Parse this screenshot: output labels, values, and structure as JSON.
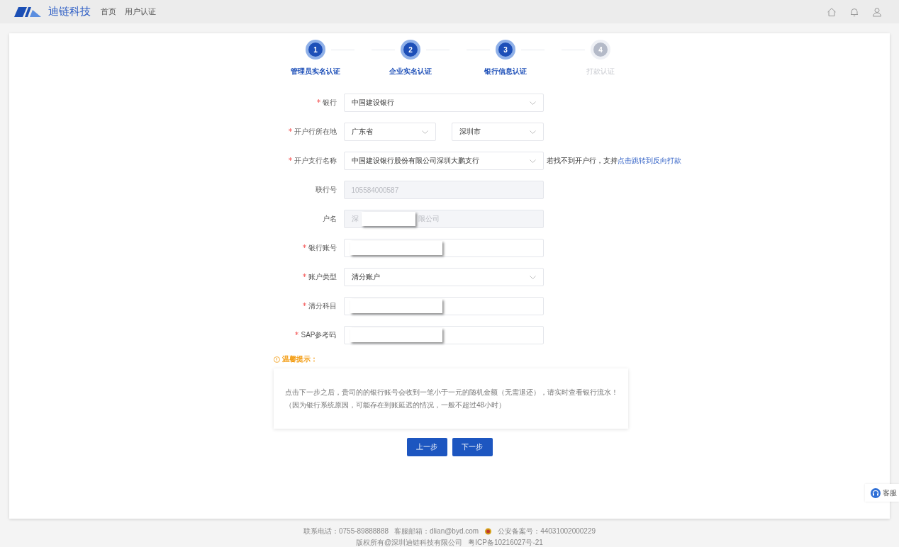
{
  "header": {
    "brand": "迪链科技",
    "nav": [
      {
        "label": "首页"
      },
      {
        "label": "用户认证"
      }
    ]
  },
  "steps": [
    {
      "number": "1",
      "label": "管理员实名认证",
      "reached": true
    },
    {
      "number": "2",
      "label": "企业实名认证",
      "reached": true
    },
    {
      "number": "3",
      "label": "银行信息认证",
      "reached": true
    },
    {
      "number": "4",
      "label": "打款认证",
      "reached": false
    }
  ],
  "fields": [
    {
      "label": "银行",
      "required": true,
      "kind": "select",
      "value": "中国建设银行"
    },
    {
      "label": "开户行所在地",
      "required": true,
      "kind": "select-pair",
      "values": [
        "广东省",
        "深圳市"
      ]
    },
    {
      "label": "开户支行名称",
      "required": true,
      "kind": "select",
      "value": "中国建设银行股份有限公司深圳大鹏支行",
      "hint": "若找不到开户行，支持",
      "hint_link": "点击跳转到反向打款"
    },
    {
      "label": "联行号",
      "required": false,
      "kind": "input",
      "disabled": true,
      "value": "105584000587"
    },
    {
      "label": "户名",
      "required": false,
      "kind": "input",
      "disabled": true,
      "value_parts": [
        "深",
        "限公司"
      ],
      "redacted": true
    },
    {
      "label": "银行账号",
      "required": true,
      "kind": "input",
      "disabled": false,
      "redacted": true
    },
    {
      "label": "账户类型",
      "required": true,
      "kind": "select",
      "value": "清分账户"
    },
    {
      "label": "清分科目",
      "required": true,
      "kind": "input",
      "disabled": false,
      "redacted": true
    },
    {
      "label": "SAP参考码",
      "required": true,
      "kind": "input",
      "disabled": false,
      "redacted": true
    }
  ],
  "notice": {
    "title": "温馨提示：",
    "lines": [
      "点击下一步之后，贵司的的银行账号会收到一笔小于一元的随机金额（无需退还），请实时查看银行流水！",
      "（因为银行系统原因，可能存在到账延迟的情况，一般不超过48小时）"
    ]
  },
  "buttons": [
    {
      "label": "上一步"
    },
    {
      "label": "下一步"
    }
  ],
  "service": {
    "label": "客服"
  },
  "footer": {
    "phone": "联系电话：0755-89888888",
    "email": "客服邮箱：dlian@byd.com",
    "police": "公安备案号：44031002000229",
    "copyright": "版权所有@深圳迪链科技有限公司",
    "icp": "粤ICP备10216027号-21"
  }
}
